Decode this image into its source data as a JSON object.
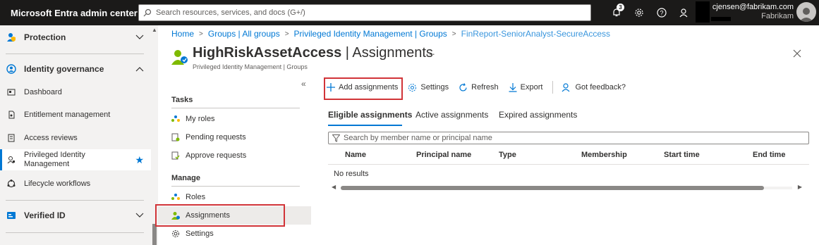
{
  "topbar": {
    "brand": "Microsoft Entra admin center",
    "search_placeholder": "Search resources, services, and docs (G+/)",
    "notification_count": "3",
    "account_email": "cjensen@fabrikam.com",
    "account_tenant": "Fabrikam"
  },
  "leftnav": {
    "protection": "Protection",
    "identity_governance": "Identity governance",
    "items": [
      {
        "label": "Dashboard",
        "icon": "dashboard-icon"
      },
      {
        "label": "Entitlement management",
        "icon": "entitlement-icon"
      },
      {
        "label": "Access reviews",
        "icon": "access-reviews-icon"
      },
      {
        "label": "Privileged Identity Management",
        "icon": "pim-icon"
      },
      {
        "label": "Lifecycle workflows",
        "icon": "lifecycle-icon"
      }
    ],
    "verified_id": "Verified ID"
  },
  "breadcrumb": [
    "Home",
    "Groups | All groups",
    "Privileged Identity Management | Groups",
    "FinReport-SeniorAnalyst-SecureAccess"
  ],
  "header": {
    "title_bold": "HighRiskAssetAccess",
    "title_rest": " | Assignments",
    "subtitle": "Privileged Identity Management | Groups",
    "more": "···"
  },
  "resource_menu": {
    "tasks_heading": "Tasks",
    "tasks": [
      "My roles",
      "Pending requests",
      "Approve requests"
    ],
    "manage_heading": "Manage",
    "manage": [
      "Roles",
      "Assignments",
      "Settings"
    ]
  },
  "commands": {
    "add": "Add assignments",
    "settings": "Settings",
    "refresh": "Refresh",
    "export": "Export",
    "feedback": "Got feedback?"
  },
  "tabs": [
    "Eligible assignments",
    "Active assignments",
    "Expired assignments"
  ],
  "filter_placeholder": "Search by member name or principal name",
  "table": {
    "columns": [
      "Name",
      "Principal name",
      "Type",
      "Membership",
      "Start time",
      "End time"
    ],
    "empty": "No results"
  },
  "colors": {
    "accent": "#0078d4",
    "highlight": "#d13438",
    "topbar": "#1b1a19"
  }
}
